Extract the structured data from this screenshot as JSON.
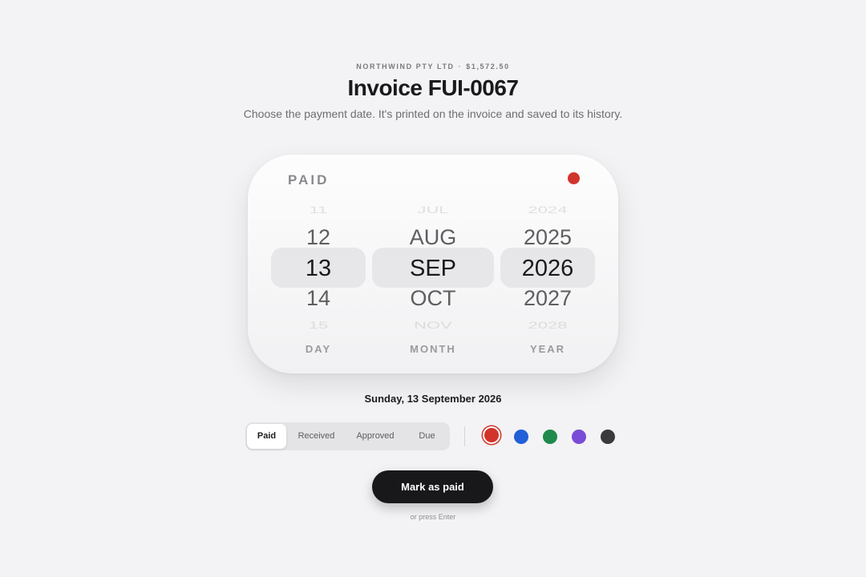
{
  "header": {
    "company": "NORTHWIND PTY LTD",
    "separator": "·",
    "amount": "$1,572.50",
    "title": "Invoice FUI-0067",
    "subtitle": "Choose the payment date. It's printed on the invoice and saved to its history."
  },
  "picker": {
    "label": "PAID",
    "status_color": "#d1342b",
    "day": {
      "label": "DAY",
      "items": [
        "11",
        "12",
        "13",
        "14",
        "15"
      ],
      "selected": "13"
    },
    "month": {
      "label": "MONTH",
      "items": [
        "JUL",
        "AUG",
        "SEP",
        "OCT",
        "NOV"
      ],
      "selected": "SEP"
    },
    "year": {
      "label": "YEAR",
      "items": [
        "2024",
        "2025",
        "2026",
        "2027",
        "2028"
      ],
      "selected": "2026"
    }
  },
  "selected_date": "Sunday, 13 September 2026",
  "status_tabs": {
    "items": [
      "Paid",
      "Received",
      "Approved",
      "Due"
    ],
    "active": "Paid"
  },
  "colors": {
    "selected": "red",
    "swatches": [
      {
        "name": "red",
        "hex": "#d1342b"
      },
      {
        "name": "blue",
        "hex": "#2160d8"
      },
      {
        "name": "green",
        "hex": "#1f8a4c"
      },
      {
        "name": "purple",
        "hex": "#7a4bd6"
      },
      {
        "name": "charcoal",
        "hex": "#3a3a3c"
      }
    ]
  },
  "action": {
    "primary_label": "Mark as paid",
    "hint": "or press Enter"
  }
}
